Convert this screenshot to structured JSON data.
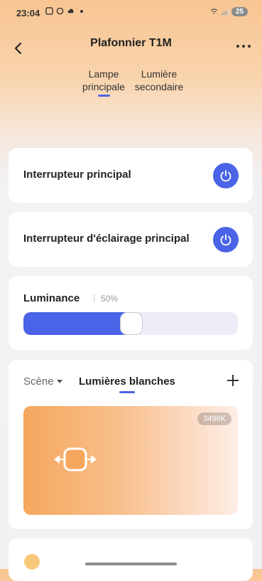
{
  "status_bar": {
    "time": "23:04",
    "battery": "25"
  },
  "header": {
    "title": "Plafonnier T1M"
  },
  "subtabs": [
    {
      "line1": "Lampe",
      "line2": "principale"
    },
    {
      "line1": "Lumière",
      "line2": "secondaire"
    }
  ],
  "switches": {
    "main": "Interrupteur principal",
    "lighting": "Interrupteur d'éclairage principal"
  },
  "luminance": {
    "label": "Luminance",
    "value": "50%",
    "level": 0.5
  },
  "scene": {
    "scene_tab": "Scène",
    "white_tab": "Lumières blanches",
    "temperature": "3496K"
  },
  "colors": {
    "accent": "#4a63e7",
    "warm": "#f6a75e"
  }
}
